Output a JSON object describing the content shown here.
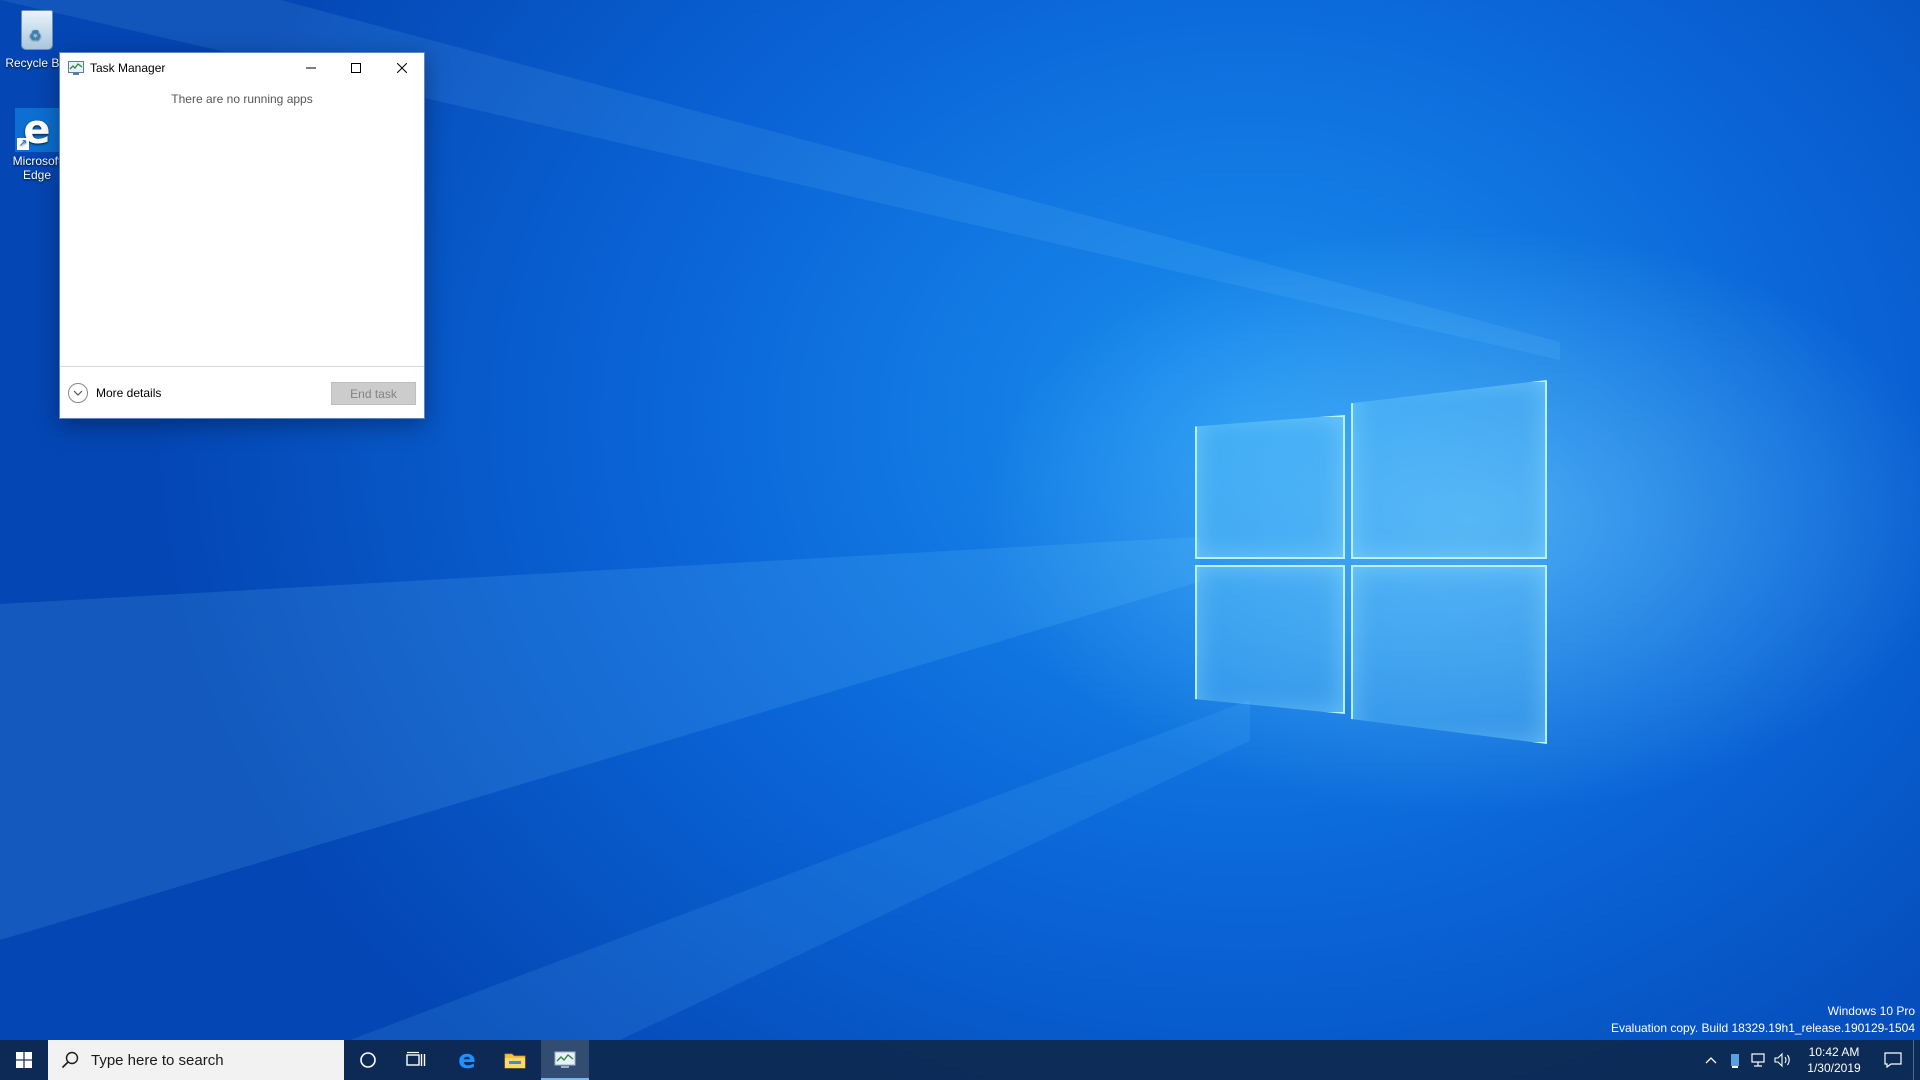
{
  "desktop": {
    "icons": [
      {
        "label": "Recycle Bin",
        "icon": "recycle-bin-icon"
      },
      {
        "label": "Microsoft Edge",
        "icon": "edge-icon"
      }
    ],
    "watermark": {
      "line1": "Windows 10 Pro",
      "line2": "Evaluation copy. Build 18329.19h1_release.190129-1504"
    }
  },
  "task_manager": {
    "title": "Task Manager",
    "empty_message": "There are no running apps",
    "more_details_label": "More details",
    "end_task_label": "End task",
    "end_task_enabled": false
  },
  "taskbar": {
    "search_placeholder": "Type here to search",
    "pinned": [
      "cortana-icon",
      "task-view-icon",
      "edge-icon",
      "file-explorer-icon",
      "task-manager-icon"
    ],
    "active_app": "Task Manager",
    "clock": {
      "time": "10:42 AM",
      "date": "1/30/2019"
    },
    "accent_color": "#76b9ed",
    "background_color": "#0e284e"
  },
  "colors": {
    "desktop_blue": "#0a64d6",
    "window_border": "#5a86c2"
  }
}
